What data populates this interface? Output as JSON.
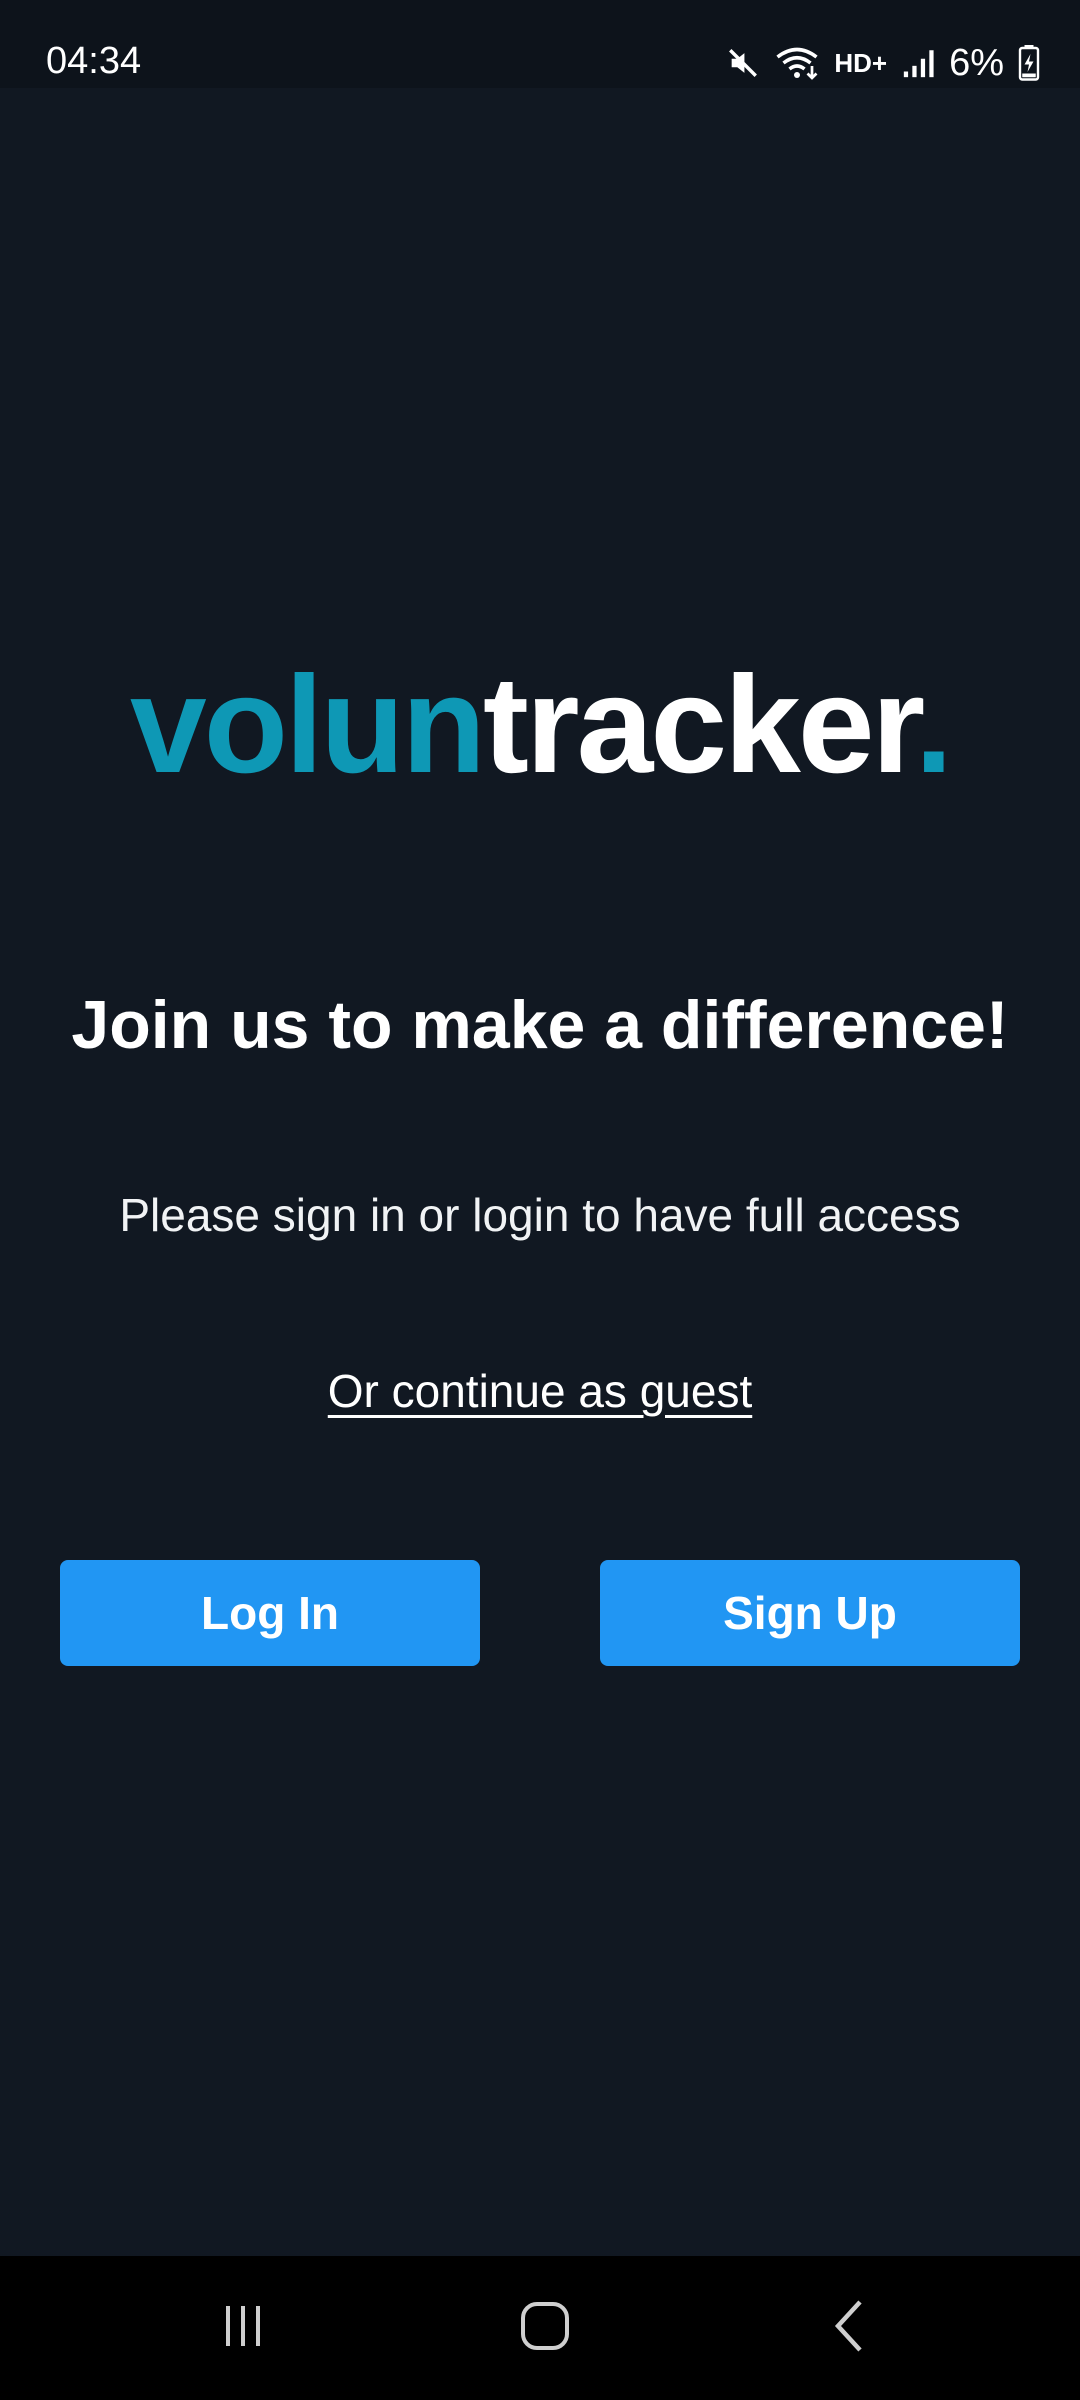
{
  "status_bar": {
    "time": "04:34",
    "battery": "6%",
    "network_badge": "HD+",
    "icons": [
      "mute-icon",
      "wifi-icon",
      "hd-voice-icon",
      "signal-icon",
      "battery-charging-icon"
    ]
  },
  "logo": {
    "part1": "volun",
    "part2": "tracker",
    "dot": ".",
    "accent_color": "#0e98b5"
  },
  "main": {
    "headline": "Join us to make a difference!",
    "subtitle": "Please sign in or login to have full access",
    "guest_link": "Or continue as guest"
  },
  "buttons": {
    "login_label": "Log In",
    "signup_label": "Sign Up",
    "color": "#2196f3"
  },
  "nav_bar": {
    "icons": [
      "recent-apps-icon",
      "home-icon",
      "back-icon"
    ]
  },
  "colors": {
    "background": "#111822",
    "status_bar": "#0d131b",
    "nav_bar": "#000000"
  }
}
